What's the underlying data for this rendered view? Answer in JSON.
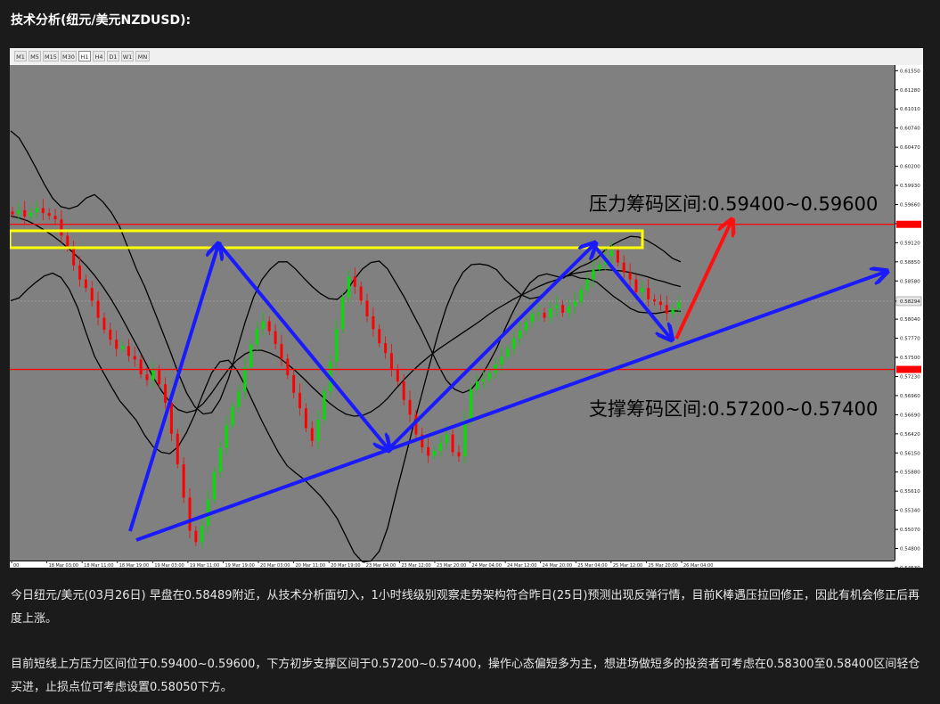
{
  "heading": "技术分析(纽元/美元NZDUSD):",
  "toolbar": {
    "timeframes": [
      "M1",
      "M5",
      "M15",
      "M30",
      "H1",
      "H4",
      "D1",
      "W1",
      "MN"
    ],
    "active": "H1"
  },
  "chart_data": {
    "type": "candlestick",
    "symbol": "NZDUSD",
    "timeframe": "H1",
    "ylim": [
      0.5463,
      0.6163
    ],
    "y_ticks": [
      "0.61550",
      "0.61280",
      "0.61010",
      "0.60740",
      "0.60470",
      "0.60200",
      "0.59930",
      "0.59660",
      "0.59390",
      "0.59120",
      "0.58850",
      "0.58580",
      "0.58294",
      "0.58040",
      "0.57770",
      "0.57500",
      "0.57230",
      "0.56960",
      "0.56690",
      "0.56420",
      "0.56150",
      "0.55880",
      "0.55610",
      "0.55340",
      "0.55070",
      "0.54800",
      "0.54530"
    ],
    "x_ticks": [
      "00",
      "18 Mar 03:00",
      "18 Mar 11:00",
      "18 Mar 19:00",
      "19 Mar 03:00",
      "19 Mar 11:00",
      "19 Mar 19:00",
      "20 Mar 03:00",
      "20 Mar 11:00",
      "20 Mar 19:00",
      "23 Mar 04:00",
      "23 Mar 12:00",
      "23 Mar 20:00",
      "24 Mar 04:00",
      "24 Mar 12:00",
      "24 Mar 20:00",
      "25 Mar 04:00",
      "25 Mar 12:00",
      "25 Mar 20:00",
      "26 Mar 04:00"
    ],
    "current_price": "0.58294",
    "resistance_line": 0.5938,
    "support_line": 0.5733,
    "resistance_label": "压力筹码区间:0.59400~0.59600",
    "support_label": "支撑筹码区间:0.57200~0.57400",
    "closes": [
      0.5952,
      0.5958,
      0.5949,
      0.5955,
      0.5961,
      0.5954,
      0.595,
      0.5945,
      0.5922,
      0.5905,
      0.588,
      0.586,
      0.5848,
      0.583,
      0.5806,
      0.5789,
      0.5775,
      0.5762,
      0.5766,
      0.5752,
      0.5747,
      0.5726,
      0.5718,
      0.5732,
      0.5712,
      0.5686,
      0.5642,
      0.5599,
      0.5552,
      0.5505,
      0.5489,
      0.5512,
      0.5549,
      0.5588,
      0.5622,
      0.5654,
      0.568,
      0.5702,
      0.5736,
      0.5768,
      0.579,
      0.5801,
      0.5787,
      0.5769,
      0.5748,
      0.5725,
      0.57,
      0.5678,
      0.565,
      0.5632,
      0.5662,
      0.5702,
      0.5744,
      0.579,
      0.5835,
      0.5864,
      0.585,
      0.583,
      0.5808,
      0.579,
      0.577,
      0.5756,
      0.5733,
      0.5716,
      0.569,
      0.5669,
      0.5641,
      0.5623,
      0.5611,
      0.5618,
      0.5629,
      0.5641,
      0.5616,
      0.561,
      0.5661,
      0.5705,
      0.5716,
      0.5719,
      0.5728,
      0.574,
      0.5751,
      0.5762,
      0.5777,
      0.5788,
      0.58,
      0.5811,
      0.5813,
      0.5806,
      0.5819,
      0.5824,
      0.5813,
      0.5822,
      0.5829,
      0.5845,
      0.586,
      0.5874,
      0.5881,
      0.5893,
      0.5901,
      0.5884,
      0.587,
      0.586,
      0.5842,
      0.5848,
      0.5832,
      0.5829,
      0.5824,
      0.5812,
      0.5819,
      0.5828
    ],
    "bands": {
      "upper": [
        0.607,
        0.606,
        0.604,
        0.6018,
        0.5995,
        0.5975,
        0.5963,
        0.596,
        0.5964,
        0.5975,
        0.598,
        0.597,
        0.5955,
        0.5935,
        0.5905,
        0.5875,
        0.585,
        0.582,
        0.579,
        0.576,
        0.5728,
        0.57,
        0.568,
        0.567,
        0.5672,
        0.569,
        0.572,
        0.576,
        0.58,
        0.5835,
        0.586,
        0.5875,
        0.5885,
        0.5885,
        0.5875,
        0.5862,
        0.585,
        0.584,
        0.5833,
        0.5832,
        0.5842,
        0.586,
        0.5875,
        0.5884,
        0.5886,
        0.5875,
        0.5855,
        0.5835,
        0.5812,
        0.579,
        0.5765,
        0.574,
        0.5718,
        0.5705,
        0.57,
        0.5705,
        0.572,
        0.574,
        0.5762,
        0.579,
        0.5815,
        0.5838,
        0.5855,
        0.5865,
        0.5868,
        0.5865,
        0.5862,
        0.587,
        0.5878,
        0.5883,
        0.589,
        0.5902,
        0.591,
        0.5916,
        0.5921,
        0.592,
        0.5915,
        0.5908,
        0.59,
        0.589,
        0.5885
      ],
      "middle": [
        0.595,
        0.5947,
        0.5943,
        0.5937,
        0.593,
        0.5922,
        0.5913,
        0.5903,
        0.5892,
        0.588,
        0.5866,
        0.585,
        0.5832,
        0.5812,
        0.579,
        0.5768,
        0.5745,
        0.5722,
        0.5703,
        0.5687,
        0.5676,
        0.5672,
        0.5675,
        0.5685,
        0.57,
        0.5717,
        0.5733,
        0.5746,
        0.5755,
        0.576,
        0.576,
        0.5756,
        0.575,
        0.5741,
        0.5731,
        0.572,
        0.5708,
        0.5697,
        0.5686,
        0.5677,
        0.567,
        0.5667,
        0.5668,
        0.5673,
        0.5681,
        0.5692,
        0.5706,
        0.5719,
        0.5731,
        0.5742,
        0.5752,
        0.5761,
        0.5769,
        0.5777,
        0.5785,
        0.5793,
        0.5801,
        0.581,
        0.5818,
        0.5825,
        0.5832,
        0.5838,
        0.5844,
        0.585,
        0.5855,
        0.5859,
        0.5863,
        0.5868,
        0.587,
        0.5872,
        0.5873,
        0.5874,
        0.5873,
        0.5872,
        0.587,
        0.5867,
        0.5864,
        0.586,
        0.5857,
        0.5853,
        0.585
      ],
      "lower": [
        0.583,
        0.5834,
        0.5846,
        0.5856,
        0.5865,
        0.5869,
        0.5863,
        0.5846,
        0.582,
        0.5785,
        0.5752,
        0.573,
        0.5709,
        0.5689,
        0.5675,
        0.5661,
        0.564,
        0.5624,
        0.5616,
        0.5614,
        0.5624,
        0.5644,
        0.567,
        0.57,
        0.5728,
        0.5744,
        0.5746,
        0.5732,
        0.571,
        0.5685,
        0.566,
        0.5637,
        0.5615,
        0.5597,
        0.5587,
        0.5578,
        0.5566,
        0.5554,
        0.5539,
        0.5522,
        0.5498,
        0.5474,
        0.5461,
        0.5462,
        0.5476,
        0.5509,
        0.5557,
        0.5603,
        0.565,
        0.5694,
        0.5739,
        0.5782,
        0.582,
        0.5849,
        0.587,
        0.5881,
        0.5882,
        0.588,
        0.5874,
        0.586,
        0.5849,
        0.5838,
        0.5833,
        0.5835,
        0.5842,
        0.5853,
        0.5864,
        0.5866,
        0.5862,
        0.5861,
        0.5856,
        0.5846,
        0.5836,
        0.5828,
        0.5819,
        0.5814,
        0.5813,
        0.5812,
        0.5814,
        0.5816,
        0.5815
      ]
    }
  },
  "paragraphs": [
    "今日纽元/美元(03月26日) 早盘在0.58489附近，从技术分析面切入，1小时线级别观察走势架构符合昨日(25日)预测出现反弹行情，目前K棒遇压拉回修正，因此有机会修正后再度上涨。",
    "目前短线上方压力区间位于0.59400~0.59600，下方初步支撑区间于0.57200~0.57400，操作心态偏短多为主，想进场做短多的投资者可考虑在0.58300至0.58400区间轻仓买进，止损点位可考虑设置0.58050下方。"
  ]
}
